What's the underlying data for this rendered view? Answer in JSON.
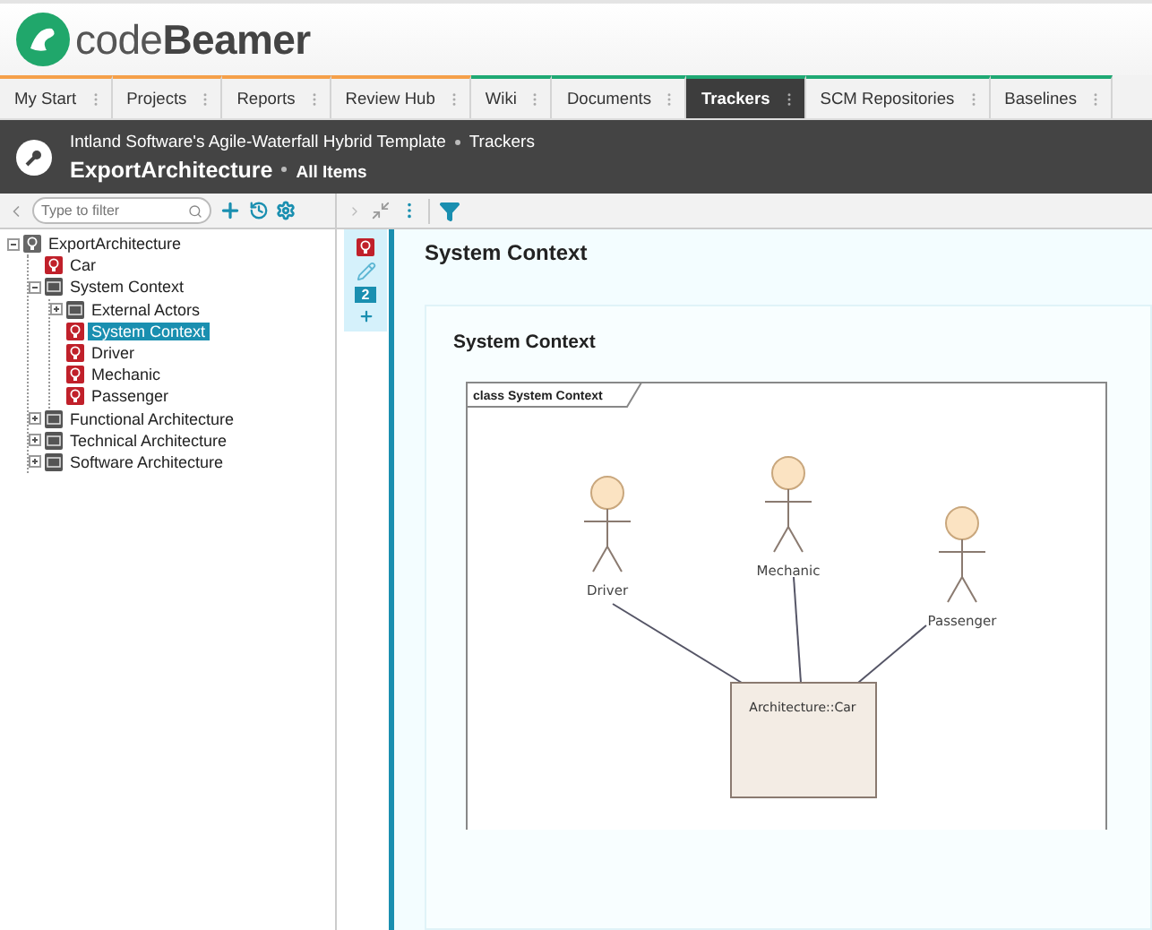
{
  "logo": {
    "text_light": "code",
    "text_bold": "Beamer"
  },
  "tabs": [
    {
      "label": "My Start",
      "selected": false,
      "color": "#f5a04a"
    },
    {
      "label": "Projects",
      "selected": false,
      "color": "#f5a04a"
    },
    {
      "label": "Reports",
      "selected": false,
      "color": "#f5a04a"
    },
    {
      "label": "Review Hub",
      "selected": false,
      "color": "#f5a04a"
    },
    {
      "label": "Wiki",
      "selected": false,
      "color": "#1fa974"
    },
    {
      "label": "Documents",
      "selected": false,
      "color": "#1fa974"
    },
    {
      "label": "Trackers",
      "selected": true,
      "color": "#1fa974"
    },
    {
      "label": "SCM Repositories",
      "selected": false,
      "color": "#1fa974"
    },
    {
      "label": "Baselines",
      "selected": false,
      "color": "#1fa974"
    }
  ],
  "breadcrumb": {
    "project": "Intland Software's Agile-Waterfall Hybrid Template",
    "section": "Trackers",
    "tracker": "ExportArchitecture",
    "view": "All Items"
  },
  "filter": {
    "placeholder": "Type to filter"
  },
  "tree": [
    {
      "label": "ExportArchitecture",
      "kind": "tracker",
      "expanded": true,
      "selected": false,
      "children": [
        {
          "label": "Car",
          "kind": "item",
          "selected": false
        },
        {
          "label": "System Context",
          "kind": "folder",
          "expanded": true,
          "selected": false,
          "children": [
            {
              "label": "External Actors",
              "kind": "folder",
              "expanded": false,
              "selected": false
            },
            {
              "label": "System Context",
              "kind": "item",
              "selected": true
            },
            {
              "label": "Driver",
              "kind": "item",
              "selected": false
            },
            {
              "label": "Mechanic",
              "kind": "item",
              "selected": false
            },
            {
              "label": "Passenger",
              "kind": "item",
              "selected": false
            }
          ]
        },
        {
          "label": "Functional Architecture",
          "kind": "folder",
          "expanded": false,
          "selected": false
        },
        {
          "label": "Technical Architecture",
          "kind": "folder",
          "expanded": false,
          "selected": false
        },
        {
          "label": "Software Architecture",
          "kind": "folder",
          "expanded": false,
          "selected": false
        }
      ]
    }
  ],
  "side_strip": {
    "comment_count": "2"
  },
  "item": {
    "title": "System Context",
    "card_title": "System Context",
    "diagram": {
      "frame_label": "class System Context",
      "actors": [
        {
          "name": "Driver"
        },
        {
          "name": "Mechanic"
        },
        {
          "name": "Passenger"
        }
      ],
      "block": {
        "name": "Architecture::Car"
      }
    }
  }
}
